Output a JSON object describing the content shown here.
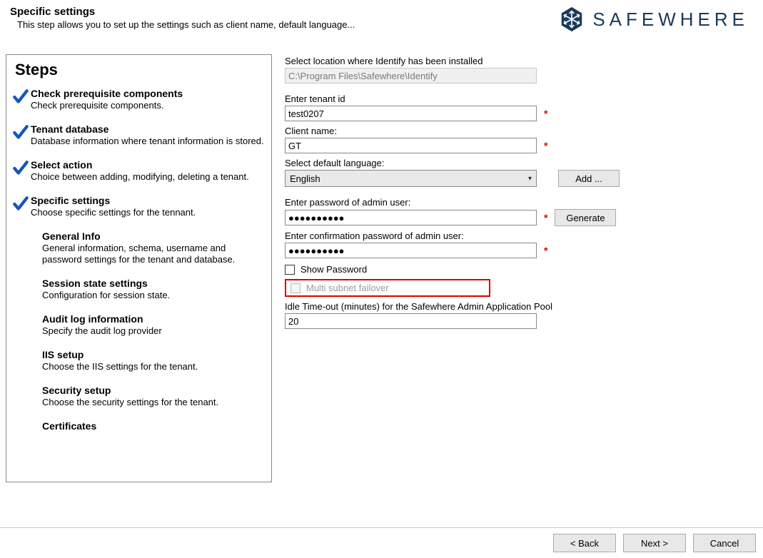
{
  "header": {
    "title": "Specific settings",
    "subtitle": "This step allows you to set up the settings such as client name, default language..."
  },
  "brand": {
    "name": "SAFEWHERE",
    "color": "#1a3a5a"
  },
  "steps": {
    "title": "Steps",
    "items": [
      {
        "title": "Check prerequisite components",
        "desc": "Check prerequisite components.",
        "checked": true
      },
      {
        "title": "Tenant database",
        "desc": "Database information where tenant information is stored.",
        "checked": true
      },
      {
        "title": "Select action",
        "desc": "Choice between adding, modifying, deleting a tenant.",
        "checked": true
      },
      {
        "title": "Specific settings",
        "desc": "Choose specific settings for the tennant.",
        "checked": true
      },
      {
        "title": "General Info",
        "desc": "General information, schema, username and password settings for the tenant and database.",
        "checked": false
      },
      {
        "title": "Session state settings",
        "desc": "Configuration for session state.",
        "checked": false
      },
      {
        "title": "Audit log information",
        "desc": "Specify the audit log provider",
        "checked": false
      },
      {
        "title": "IIS setup",
        "desc": "Choose the IIS settings for the tenant.",
        "checked": false
      },
      {
        "title": "Security setup",
        "desc": "Choose the security settings for the tenant.",
        "checked": false
      },
      {
        "title": "Certificates",
        "desc": "",
        "checked": false
      }
    ]
  },
  "form": {
    "install_location_label": "Select location where Identify has been installed",
    "install_location_value": "C:\\Program Files\\Safewhere\\Identify",
    "tenant_id_label": "Enter tenant id",
    "tenant_id_value": "test0207",
    "client_name_label": "Client name:",
    "client_name_value": "GT",
    "language_label": "Select default language:",
    "language_value": "English",
    "add_btn": "Add ...",
    "password_label": "Enter password of admin user:",
    "password_value": "●●●●●●●●●●",
    "generate_btn": "Generate",
    "password_confirm_label": "Enter confirmation password of admin user:",
    "password_confirm_value": "●●●●●●●●●●",
    "show_password_label": "Show Password",
    "multi_subnet_label": "Multi subnet failover",
    "idle_timeout_label": "Idle Time-out (minutes) for the Safewhere Admin Application Pool",
    "idle_timeout_value": "20"
  },
  "footer": {
    "back": "< Back",
    "next": "Next >",
    "cancel": "Cancel"
  }
}
